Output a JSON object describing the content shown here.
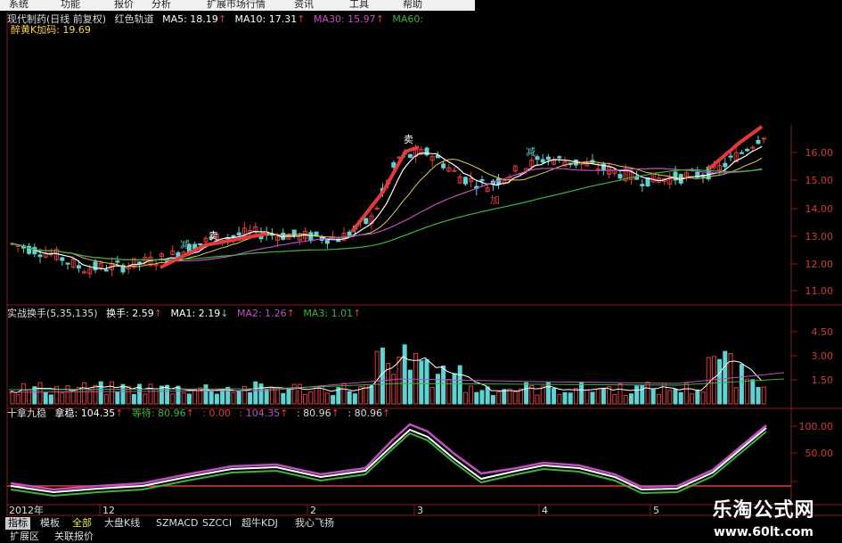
{
  "menu": [
    "系统",
    "功能",
    "报价",
    "分析",
    "扩展市场行情",
    "资讯",
    "工具",
    "帮助"
  ],
  "kline_header": {
    "name": "现代制药(日线 前复权)",
    "indicator": "红色轨道",
    "ma5": "MA5: 18.19",
    "ma10": "MA10: 17.31",
    "ma30": "MA30: 15.97",
    "ma60": "MA60:",
    "line2": "醉黄K加码: 19.69"
  },
  "price_axis": [
    "16.00",
    "15.00",
    "14.00",
    "13.00",
    "12.00",
    "11.00"
  ],
  "volume_header": {
    "name": "实战换手(5,35,135)",
    "turnover": "换手: 2.59",
    "ma1": "MA1: 2.19",
    "ma2": "MA2: 1.26",
    "ma3": "MA3: 1.01"
  },
  "volume_axis": [
    "4.50",
    "3.00",
    "1.50"
  ],
  "osc_header": {
    "name": "十拿九稳",
    "v1": "拿稳: 104.35",
    "v2": "等待: 80.96",
    "v3": ": 0.00",
    "v4": ": 104.35",
    "v5": ": 80.96",
    "v6": ": 80.96"
  },
  "osc_axis": [
    "100.00",
    "50.00"
  ],
  "date_axis": [
    "2012年",
    "12",
    "2",
    "3",
    "4",
    "5"
  ],
  "bottom_tabs": [
    "指标",
    "模板",
    "全部",
    "大盘K线",
    "SZMACD",
    "SZCCI",
    "超牛KDJ",
    "我心飞扬"
  ],
  "bottom_tabs2": [
    "扩展区",
    "关联报价"
  ],
  "signals": [
    "卖",
    "减",
    "加",
    "卖",
    "减"
  ],
  "watermark": {
    "title": "乐淘公式网",
    "url": "www.60lt.com"
  },
  "colors": {
    "up": "#e23b3b",
    "down": "#5fd2d2",
    "ma5": "#ffffff",
    "ma30": "#c24fc2",
    "ma60": "#3cb43c",
    "grid": "#8a1a1a"
  }
}
